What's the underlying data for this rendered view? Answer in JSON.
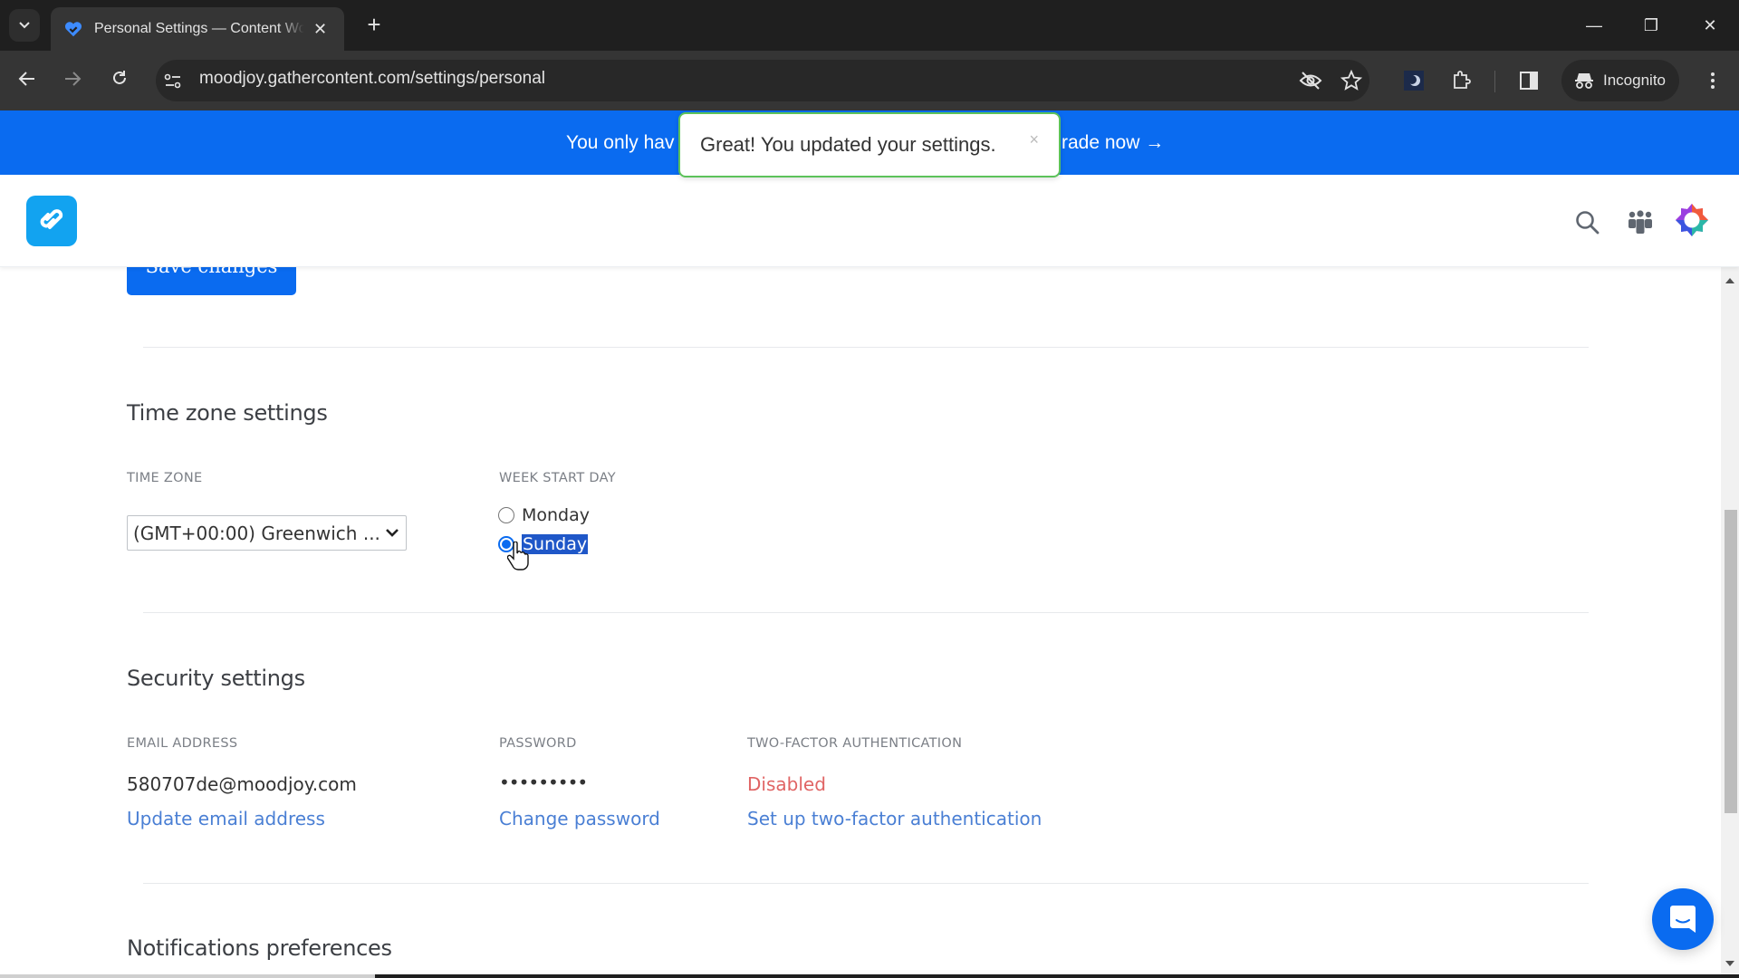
{
  "browser": {
    "tab_title": "Personal Settings — Content Workflow",
    "tab_close": "✕",
    "new_tab": "+",
    "url": "moodjoy.gathercontent.com/settings/personal",
    "incognito_label": "Incognito",
    "window_controls": {
      "minimize": "—",
      "restore": "❐",
      "close": "✕"
    }
  },
  "banner": {
    "left_text": "You only hav",
    "right_text": "rade now →",
    "color": "#0a6bf0"
  },
  "toast": {
    "message": "Great! You updated your settings.",
    "close": "×",
    "border_color": "#5cc25a"
  },
  "header": {
    "logo": "gathercontent-logo",
    "icons": [
      "search-icon",
      "team-icon",
      "account-icon"
    ]
  },
  "actions": {
    "save_label": "Save changes"
  },
  "timezone_section": {
    "title": "Time zone settings",
    "timezone_label": "TIME ZONE",
    "timezone_value": "(GMT+00:00) Greenwich ...",
    "week_start_label": "WEEK START DAY",
    "week_options": [
      {
        "label": "Monday",
        "checked": false
      },
      {
        "label": "Sunday",
        "checked": true
      }
    ]
  },
  "security_section": {
    "title": "Security settings",
    "email_label": "EMAIL ADDRESS",
    "email_value": "580707de@moodjoy.com",
    "email_link": "Update email address",
    "password_label": "PASSWORD",
    "password_value": "•••••••••",
    "password_link": "Change password",
    "twofa_label": "TWO-FACTOR AUTHENTICATION",
    "twofa_value": "Disabled",
    "twofa_link": "Set up two-factor authentication"
  },
  "notifications_section": {
    "title": "Notifications preferences"
  },
  "colors": {
    "accent": "#0a6bf0",
    "link": "#4a7fd4",
    "danger": "#e06464"
  }
}
